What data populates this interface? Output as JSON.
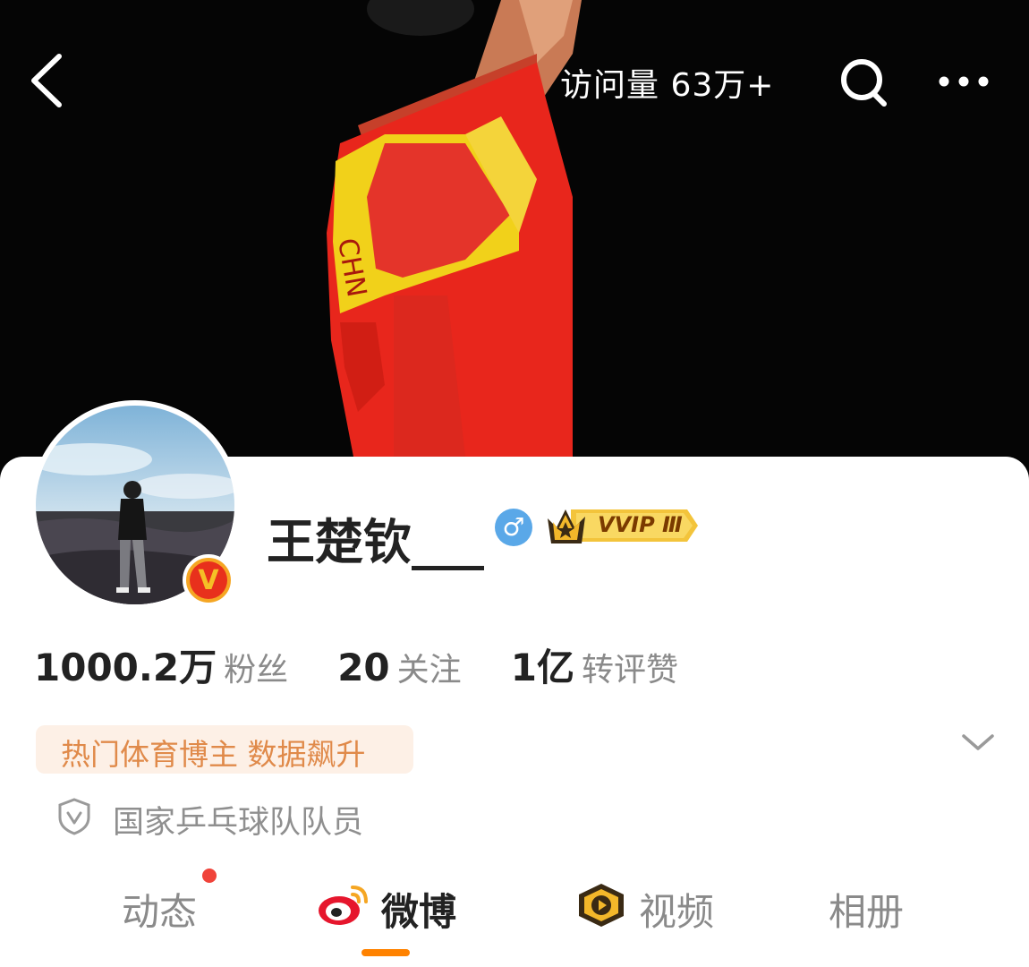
{
  "header": {
    "visits_text": "访问量 63万+",
    "icons": [
      "back-icon",
      "search-icon",
      "more-icon"
    ]
  },
  "profile": {
    "name": "王楚钦___",
    "gender_symbol": "♂",
    "vip_badge_text": "VVIP Ⅲ",
    "verified_badge": "V",
    "stats": [
      {
        "value": "1000.2万",
        "label": "粉丝"
      },
      {
        "value": "20",
        "label": "关注"
      },
      {
        "value": "1亿",
        "label": "转评赞"
      }
    ],
    "hot_tag": "热门体育博主 数据飙升",
    "certification": "国家乒乓球队队员"
  },
  "tabs": [
    {
      "label": "动态",
      "has_dot": true
    },
    {
      "label": "微博",
      "active": true
    },
    {
      "label": "视频"
    },
    {
      "label": "相册"
    }
  ],
  "colors": {
    "accent": "#ff8200",
    "tag_bg": "#fdf0e6",
    "tag_text": "#e08a4a",
    "gender_blue": "#5aa8e8",
    "dot_red": "#f0433a"
  }
}
